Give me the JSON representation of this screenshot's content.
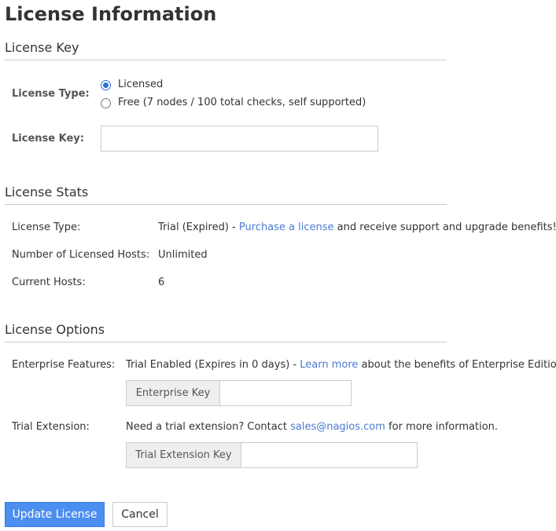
{
  "page": {
    "title": "License Information"
  },
  "license_key": {
    "heading": "License Key",
    "type_label": "License Type:",
    "options": [
      {
        "label": "Licensed",
        "checked": true
      },
      {
        "label": "Free (7 nodes / 100 total checks, self supported)",
        "checked": false
      }
    ],
    "key_label": "License Key:",
    "key_value": "",
    "key_placeholder": ""
  },
  "license_stats": {
    "heading": "License Stats",
    "type_label": "License Type:",
    "type_value": "Trial (Expired) - ",
    "purchase_link": "Purchase a license",
    "type_suffix": " and receive support and upgrade benefits!",
    "hosts_label": "Number of Licensed Hosts:",
    "hosts_value": "Unlimited",
    "current_label": "Current Hosts:",
    "current_value": "6"
  },
  "license_options": {
    "heading": "License Options",
    "enterprise_label": "Enterprise Features:",
    "enterprise_value": "Trial Enabled (Expires in 0 days) - ",
    "learn_more_link": "Learn more",
    "enterprise_suffix": " about the benefits of Enterprise Edition",
    "enterprise_key_addon": "Enterprise Key",
    "trial_label": "Trial Extension:",
    "trial_text": "Need a trial extension? Contact ",
    "trial_email": "sales@nagios.com",
    "trial_suffix": " for more information.",
    "trial_key_addon": "Trial Extension Key"
  },
  "actions": {
    "update_label": "Update License",
    "cancel_label": "Cancel"
  },
  "colors": {
    "primary": "#4d8ff0",
    "link": "#4a7bd1",
    "radio_checked": "#2f6fd6"
  }
}
